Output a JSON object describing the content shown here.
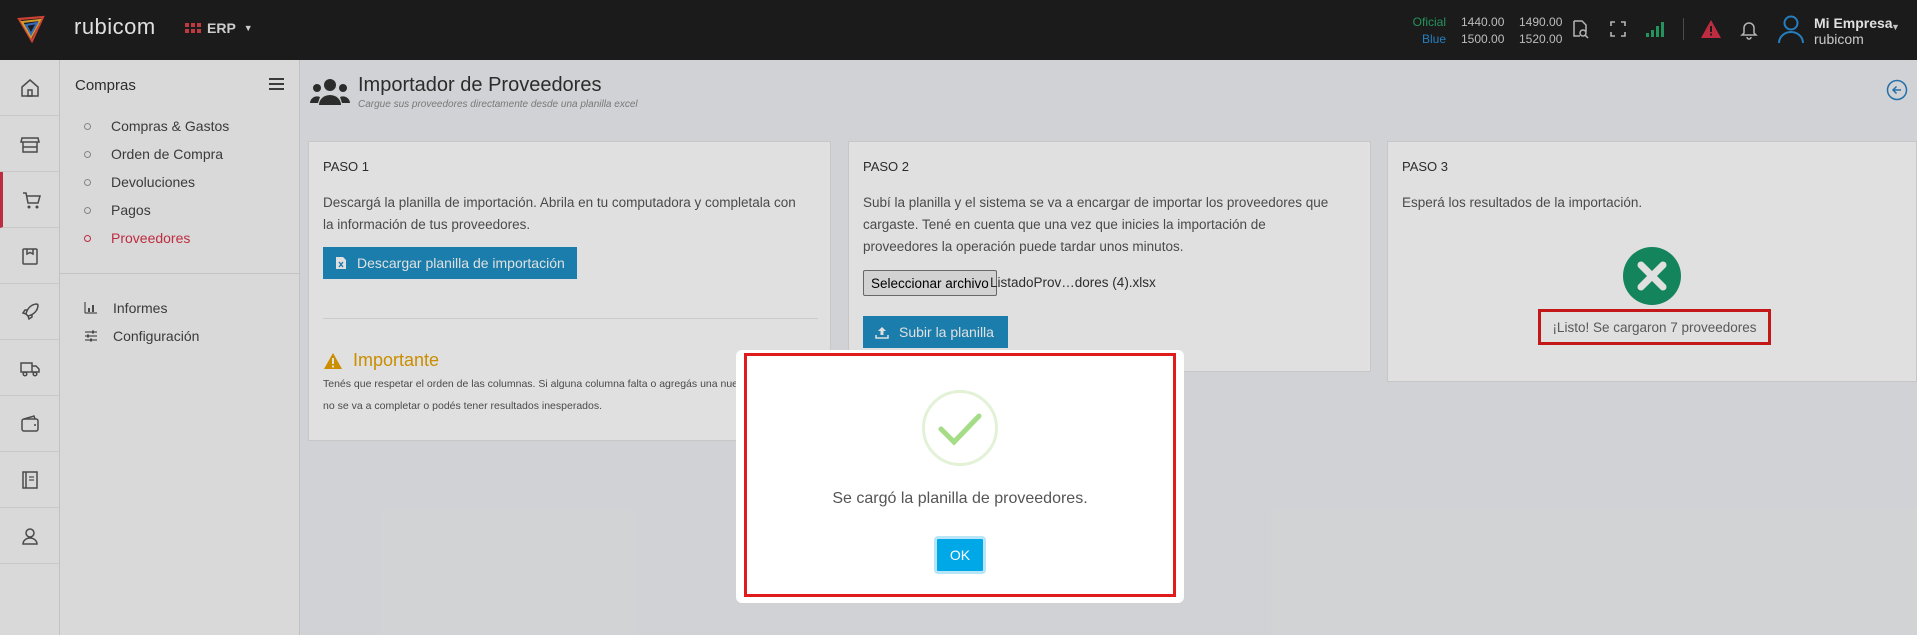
{
  "topbar": {
    "brand": "rubicom",
    "module": "ERP",
    "rates": [
      {
        "label": "Oficial",
        "buy": "1440.00",
        "sell": "1490.00"
      },
      {
        "label": "Blue",
        "buy": "1500.00",
        "sell": "1520.00"
      }
    ],
    "user": {
      "name": "Mi Empresa",
      "company": "rubicom"
    },
    "colors": {
      "bar": "#1f1f1f",
      "oficial": "#2aa86a",
      "blue": "#2b90d9",
      "accent": "#d9334a"
    }
  },
  "rail": {
    "icons": [
      "home-icon",
      "store-icon",
      "cart-icon",
      "box-icon",
      "rocket-icon",
      "truck-icon",
      "wallet-icon",
      "book-icon",
      "user-icon"
    ],
    "active": "cart-icon"
  },
  "submenu": {
    "title": "Compras",
    "items": [
      {
        "label": "Compras & Gastos"
      },
      {
        "label": "Orden de Compra"
      },
      {
        "label": "Devoluciones"
      },
      {
        "label": "Pagos"
      },
      {
        "label": "Proveedores"
      }
    ],
    "active_item": "Proveedores",
    "extra": [
      {
        "label": "Informes",
        "icon": "chart-icon"
      },
      {
        "label": "Configuración",
        "icon": "sliders-icon"
      }
    ]
  },
  "page": {
    "title": "Importador de Proveedores",
    "subtitle": "Cargue sus proveedores directamente desde una planilla excel"
  },
  "step1": {
    "title": "PASO 1",
    "text_line1": "Descargá la planilla de importación. Abrila en tu computadora y completala con",
    "text_line2": "la información de tus proveedores.",
    "button": "Descargar planilla de importación",
    "important_title": "Importante",
    "important_line1": "Tenés que respetar el orden de las columnas. Si alguna columna falta o agregás una nueva",
    "important_line2": "no se va a completar o podés tener resultados inesperados."
  },
  "step2": {
    "title": "PASO 2",
    "text_line1": "Subí la planilla y el sistema se va a encargar de importar los proveedores que",
    "text_line2": "cargaste. Tené en cuenta que una vez que inicies la importación de",
    "text_line3": "proveedores la operación puede tardar unos minutos.",
    "file_button": "Seleccionar archivo",
    "file_name": "ListadoProv…dores (4).xlsx",
    "upload_button": "Subir la planilla"
  },
  "step3": {
    "title": "PASO 3",
    "text": "Esperá los resultados de la importación.",
    "result": "¡Listo! Se cargaron 7 proveedores",
    "status_icon": "x-circle-icon"
  },
  "modal": {
    "message": "Se cargó la planilla de proveedores.",
    "ok": "OK",
    "icon": "check-icon"
  }
}
